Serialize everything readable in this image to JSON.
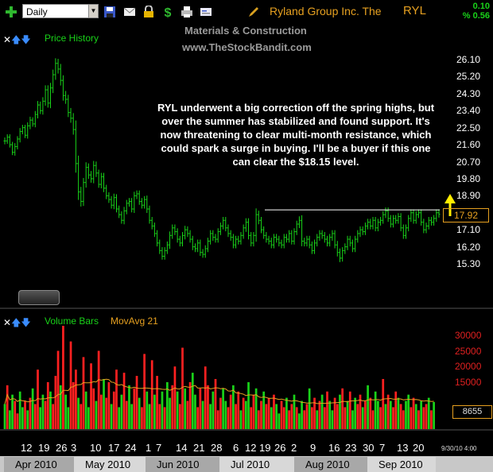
{
  "toolbar": {
    "period": "Daily",
    "symbol_name": "Ryland Group Inc. The",
    "symbol": "RYL",
    "change": "0.10",
    "change_pct": "% 0.56",
    "icons": [
      "add-icon",
      "save-icon",
      "email-icon",
      "lock-icon",
      "dollar-icon",
      "print-icon",
      "card-icon",
      "pencil-icon"
    ]
  },
  "watermark": {
    "line1": "Materials & Construction",
    "line2": "www.TheStockBandit.com"
  },
  "price_panel": {
    "label": "Price History",
    "annotation": "RYL underwent a big correction off the spring highs, but over the summer has stabilized and found support.  It's now threatening to clear multi-month resistance, which could spark a surge in buying.  I'll be a buyer if this one can clear the $18.15 level.",
    "last_price": "17.92",
    "y_ticks": [
      "26.10",
      "25.20",
      "24.30",
      "23.40",
      "22.50",
      "21.60",
      "20.70",
      "19.80",
      "18.90",
      "17.10",
      "16.20",
      "15.30"
    ]
  },
  "volume_panel": {
    "label": "Volume Bars",
    "ma_label": "MovAvg 21",
    "last_volume": "8655",
    "y_ticks": [
      "30000",
      "25000",
      "20000",
      "15000"
    ]
  },
  "x_axis": {
    "day_labels": [
      "12",
      "19",
      "26",
      "3",
      "10",
      "17",
      "24",
      "1",
      "7",
      "14",
      "21",
      "28",
      "6",
      "12",
      "19",
      "26",
      "2",
      "9",
      "16",
      "23",
      "30",
      "7",
      "13",
      "20"
    ],
    "month_labels": [
      "Apr 2010",
      "May 2010",
      "Jun 2010",
      "Jul 2010",
      "Aug 2010",
      "Sep 2010"
    ],
    "end_date": "9/30/10 4:00"
  },
  "colors": {
    "up": "#19d219",
    "down": "#ff2020",
    "accent": "#e6a020",
    "resistance": "#ffffff"
  },
  "chart_data": [
    {
      "type": "ohlc",
      "title": "Price History",
      "ylim": [
        14.8,
        26.6
      ],
      "resistance": 18.15,
      "close": [
        21.8,
        22.0,
        21.6,
        21.2,
        21.5,
        21.9,
        22.3,
        22.5,
        22.1,
        22.6,
        22.9,
        22.7,
        23.2,
        23.7,
        23.4,
        23.9,
        24.5,
        23.8,
        24.6,
        25.3,
        25.9,
        25.6,
        25.0,
        24.2,
        24.0,
        23.3,
        23.0,
        22.4,
        20.6,
        19.1,
        18.6,
        19.6,
        20.4,
        20.0,
        19.8,
        20.5,
        20.1,
        19.5,
        19.9,
        19.3,
        18.9,
        18.7,
        18.4,
        18.8,
        18.2,
        17.9,
        17.6,
        18.1,
        18.5,
        18.6,
        18.2,
        18.9,
        19.0,
        18.6,
        18.4,
        18.7,
        18.2,
        17.6,
        17.3,
        16.9,
        16.4,
        16.0,
        15.7,
        16.0,
        16.3,
        16.8,
        17.2,
        17.0,
        16.6,
        16.4,
        16.8,
        17.1,
        16.9,
        16.6,
        16.2,
        16.1,
        16.4,
        15.9,
        15.8,
        16.1,
        16.5,
        16.9,
        16.7,
        16.6,
        17.0,
        17.3,
        17.6,
        17.2,
        16.9,
        16.7,
        16.3,
        16.6,
        16.5,
        16.8,
        17.2,
        17.5,
        16.8,
        16.4,
        16.8,
        17.9,
        17.6,
        17.1,
        16.8,
        16.6,
        16.5,
        16.3,
        16.7,
        16.6,
        16.4,
        16.3,
        16.7,
        16.6,
        16.9,
        16.5,
        17.0,
        17.4,
        17.6,
        16.5,
        16.4,
        16.6,
        16.3,
        16.0,
        16.4,
        16.7,
        16.9,
        16.8,
        16.6,
        16.4,
        16.7,
        16.9,
        16.3,
        15.9,
        15.6,
        16.0,
        16.2,
        16.6,
        16.4,
        16.1,
        16.6,
        16.9,
        17.1,
        17.0,
        17.3,
        17.5,
        17.3,
        17.6,
        17.2,
        17.5,
        17.6,
        17.9,
        18.1,
        17.7,
        17.4,
        17.7,
        17.6,
        17.8,
        17.2,
        16.8,
        17.2,
        17.7,
        18.0,
        17.6,
        17.9,
        18.0,
        17.5,
        17.1,
        17.3,
        17.6,
        17.5,
        17.7,
        18.0,
        17.92
      ],
      "range": [
        0.6,
        0.5,
        0.5,
        0.5,
        0.6,
        0.5,
        0.6,
        0.5,
        0.5,
        0.6,
        0.6,
        0.5,
        0.6,
        0.7,
        0.6,
        0.7,
        0.8,
        0.8,
        0.9,
        0.9,
        0.9,
        0.8,
        0.9,
        0.9,
        0.8,
        0.8,
        0.8,
        0.9,
        1.6,
        1.4,
        0.9,
        0.8,
        0.9,
        0.7,
        0.7,
        0.8,
        0.7,
        0.6,
        0.7,
        0.7,
        0.6,
        0.6,
        0.6,
        0.7,
        0.6,
        0.6,
        0.6,
        0.7,
        0.6,
        0.6,
        0.6,
        0.7,
        0.6,
        0.6,
        0.6,
        0.6,
        0.7,
        0.6,
        0.6,
        0.6,
        0.6,
        0.6,
        0.6,
        0.6,
        0.6,
        0.7,
        0.6,
        0.6,
        0.6,
        0.6,
        0.6,
        0.7,
        0.6,
        0.6,
        0.6,
        0.6,
        0.6,
        0.6,
        0.6,
        0.6,
        0.6,
        0.6,
        0.6,
        0.6,
        0.6,
        0.6,
        0.6,
        0.6,
        0.6,
        0.6,
        0.6,
        0.6,
        0.6,
        0.6,
        0.6,
        0.7,
        0.7,
        0.6,
        0.6,
        1.1,
        0.7,
        0.6,
        0.6,
        0.6,
        0.6,
        0.6,
        0.6,
        0.6,
        0.6,
        0.6,
        0.6,
        0.6,
        0.6,
        0.6,
        0.6,
        0.6,
        0.7,
        0.9,
        0.6,
        0.6,
        0.6,
        0.6,
        0.6,
        0.6,
        0.6,
        0.6,
        0.6,
        0.6,
        0.6,
        0.6,
        0.6,
        0.7,
        0.7,
        0.6,
        0.6,
        0.6,
        0.6,
        0.6,
        0.6,
        0.6,
        0.6,
        0.6,
        0.6,
        0.6,
        0.6,
        0.6,
        0.6,
        0.6,
        0.6,
        0.6,
        0.6,
        0.6,
        0.6,
        0.6,
        0.6,
        0.6,
        0.6,
        0.6,
        0.6,
        0.6,
        0.6,
        0.6,
        0.6,
        0.6,
        0.6,
        0.6,
        0.6,
        0.6,
        0.6,
        0.6,
        0.6,
        0.6,
        0.6,
        0.6
      ]
    },
    {
      "type": "bar",
      "title": "Volume Bars",
      "ylim": [
        0,
        33000
      ],
      "values": [
        8000,
        14000,
        6000,
        11000,
        9000,
        5000,
        12000,
        7000,
        9000,
        6000,
        10000,
        13000,
        8000,
        19000,
        7000,
        11000,
        9000,
        15000,
        12000,
        8000,
        17000,
        25000,
        14000,
        33000,
        11000,
        7000,
        28000,
        15000,
        19000,
        10000,
        8000,
        23000,
        12000,
        7000,
        21000,
        13000,
        9000,
        25000,
        11000,
        16000,
        10000,
        15000,
        8000,
        12000,
        19000,
        7000,
        11000,
        18000,
        9000,
        14000,
        8000,
        13000,
        17000,
        10000,
        7000,
        24000,
        12000,
        8000,
        22000,
        11000,
        17000,
        8000,
        12000,
        7000,
        15000,
        10000,
        14000,
        20000,
        12000,
        8000,
        26000,
        13000,
        9000,
        15000,
        18000,
        11000,
        7000,
        13000,
        9000,
        20000,
        14000,
        8000,
        12000,
        16000,
        6000,
        10000,
        13000,
        9000,
        7000,
        11000,
        14000,
        8000,
        12000,
        6000,
        10000,
        9000,
        15000,
        7000,
        11000,
        13000,
        6000,
        9000,
        12000,
        8000,
        10000,
        7000,
        11000,
        8000,
        5000,
        9000,
        7000,
        10000,
        6000,
        8000,
        11000,
        7000,
        5000,
        9000,
        6000,
        8000,
        13000,
        7000,
        10000,
        6000,
        9000,
        11000,
        7000,
        12000,
        9000,
        6000,
        10000,
        8000,
        11000,
        13000,
        7000,
        9000,
        12000,
        6000,
        10000,
        8000,
        11000,
        7000,
        9000,
        14000,
        10000,
        6000,
        12000,
        9000,
        7000,
        16000,
        8000,
        11000,
        9000,
        7000,
        12000,
        10000,
        8000,
        6000,
        9000,
        11000,
        7000,
        10000,
        8000,
        6000,
        9000,
        7000,
        8000,
        10000,
        6000,
        8655
      ],
      "up": [
        1,
        0,
        1,
        1,
        0,
        0,
        1,
        1,
        0,
        1,
        0,
        1,
        0,
        0,
        1,
        1,
        0,
        0,
        1,
        0,
        0,
        0,
        1,
        0,
        1,
        1,
        0,
        0,
        0,
        1,
        0,
        0,
        1,
        1,
        0,
        0,
        1,
        0,
        0,
        1,
        0,
        0,
        1,
        0,
        0,
        1,
        1,
        0,
        0,
        1,
        1,
        0,
        0,
        1,
        0,
        0,
        1,
        1,
        0,
        1,
        0,
        0,
        1,
        0,
        1,
        1,
        0,
        0,
        1,
        0,
        0,
        1,
        0,
        0,
        1,
        1,
        0,
        0,
        1,
        0,
        0,
        1,
        1,
        0,
        0,
        0,
        1,
        1,
        0,
        0,
        1,
        0,
        0,
        1,
        0,
        1,
        1,
        0,
        0,
        1,
        0,
        0,
        1,
        0,
        0,
        1,
        0,
        1,
        1,
        0,
        0,
        1,
        0,
        0,
        1,
        0,
        1,
        1,
        0,
        0,
        1,
        0,
        0,
        1,
        0,
        1,
        0,
        0,
        1,
        1,
        0,
        0,
        1,
        0,
        0,
        1,
        0,
        1,
        1,
        0,
        0,
        1,
        0,
        1,
        0,
        0,
        1,
        1,
        0,
        0,
        1,
        0,
        1,
        0,
        0,
        1,
        0,
        0,
        1,
        1,
        0,
        0,
        1,
        0,
        1,
        0,
        0,
        1,
        0,
        1,
        1
      ],
      "ma_period": 21
    }
  ]
}
